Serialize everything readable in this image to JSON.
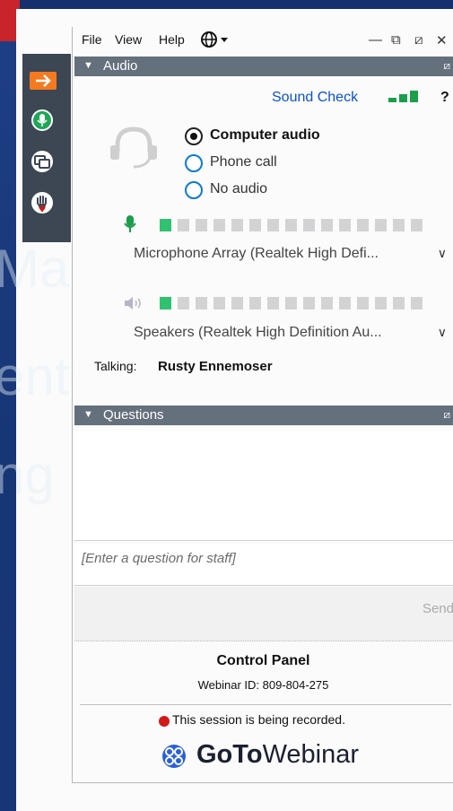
{
  "background": {
    "text_lines": [
      "Marion",
      "ent",
      "ng"
    ]
  },
  "toolbar": {
    "buttons": [
      "arrow-icon",
      "microphone-icon",
      "screen-share-icon",
      "raise-hand-icon"
    ]
  },
  "menu": {
    "items": [
      "File",
      "View",
      "Help"
    ],
    "language_icon": "globe-icon"
  },
  "audio": {
    "title": "Audio",
    "sound_check": "Sound Check",
    "help": "?",
    "options": [
      "Computer audio",
      "Phone call",
      "No audio"
    ],
    "selected": "Computer audio",
    "microphone_device": "Microphone Array (Realtek High Defi...",
    "microphone_level": 1,
    "speaker_device": "Speakers (Realtek High Definition Au...",
    "speaker_level": 1,
    "meter_segments": 15,
    "talking_label": "Talking:",
    "talking_name": "Rusty Ennemoser"
  },
  "questions": {
    "title": "Questions",
    "placeholder": "[Enter a question for staff]",
    "send_label": "Send"
  },
  "control_panel": {
    "title": "Control Panel",
    "webinar_id": "Webinar ID: 809-804-275",
    "recording_text": "This session is being recorded.",
    "logo_bold": "GoTo",
    "logo_light": "Webinar"
  },
  "colors": {
    "accent_blue": "#0a7bcf",
    "meter_green": "#2fc271",
    "header_gray": "#65707d",
    "record_red": "#d21919",
    "toolbar_orange": "#f47a20"
  }
}
